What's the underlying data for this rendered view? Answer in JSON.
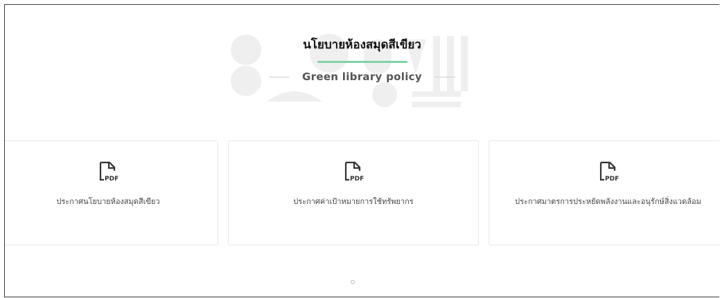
{
  "header": {
    "title_th": "นโยบายห้องสมุดสีเขียว",
    "title_en": "Green library policy",
    "accent_color": "#7ed3a2"
  },
  "cards": [
    {
      "label": "ประกาศนโยบายห้องสมุดสีเขียว",
      "icon": "pdf-file-icon",
      "icon_text": "PDF"
    },
    {
      "label": "ประกาศค่าเป้าหมายการใช้ทรัพยากร",
      "icon": "pdf-file-icon",
      "icon_text": "PDF"
    },
    {
      "label": "ประกาศมาตรการประหยัดพลังงานและอนุรักษ์สิ่งแวดล้อม",
      "icon": "pdf-file-icon",
      "icon_text": "PDF"
    }
  ],
  "pagination": {
    "dots": 1
  }
}
